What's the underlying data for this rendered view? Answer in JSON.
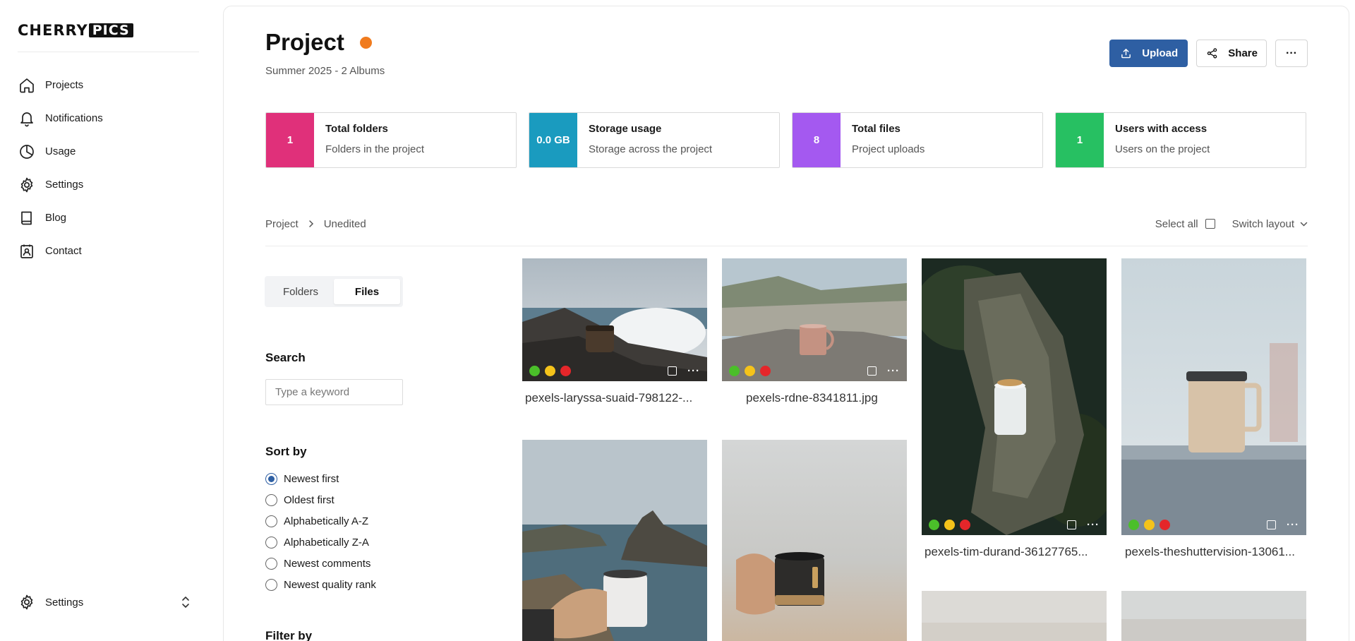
{
  "brand": {
    "logo_left": "CHERRY",
    "logo_right": "PICS"
  },
  "sidebar": {
    "items": [
      {
        "label": "Projects",
        "icon": "home-icon"
      },
      {
        "label": "Notifications",
        "icon": "bell-icon"
      },
      {
        "label": "Usage",
        "icon": "pie-chart-icon"
      },
      {
        "label": "Settings",
        "icon": "gear-icon"
      },
      {
        "label": "Blog",
        "icon": "book-icon"
      },
      {
        "label": "Contact",
        "icon": "contact-icon"
      }
    ],
    "bottom": {
      "label": "Settings",
      "icon": "gear-icon",
      "toggle_icon": "chevron-up-down-icon"
    }
  },
  "header": {
    "title": "Project",
    "status_color": "#f07b1e",
    "subtitle": "Summer 2025 - 2 Albums",
    "upload_label": "Upload",
    "share_label": "Share",
    "more_label": "···"
  },
  "stats": [
    {
      "value": "1",
      "title": "Total folders",
      "subtitle": "Folders in the project",
      "color": "#e0307a"
    },
    {
      "value": "0.0 GB",
      "title": "Storage usage",
      "subtitle": "Storage across the project",
      "color": "#1a9bbf"
    },
    {
      "value": "8",
      "title": "Total files",
      "subtitle": "Project uploads",
      "color": "#a459f0"
    },
    {
      "value": "1",
      "title": "Users with access",
      "subtitle": "Users on the project",
      "color": "#27c062"
    }
  ],
  "breadcrumb": {
    "root": "Project",
    "current": "Unedited"
  },
  "toolbar": {
    "select_all": "Select all",
    "switch_layout": "Switch layout"
  },
  "view_toggle": {
    "folders": "Folders",
    "files": "Files",
    "active": "Files"
  },
  "search": {
    "label": "Search",
    "placeholder": "Type a keyword",
    "value": ""
  },
  "sort": {
    "label": "Sort by",
    "options": [
      "Newest first",
      "Oldest first",
      "Alphabetically A-Z",
      "Alphabetically Z-A",
      "Newest comments",
      "Newest quality rank"
    ],
    "selected": "Newest first"
  },
  "filter": {
    "label": "Filter by"
  },
  "files": [
    {
      "name": "pexels-laryssa-suaid-798122-...",
      "labels": [
        "green",
        "yellow",
        "red"
      ]
    },
    {
      "name": "pexels-rdne-8341811.jpg",
      "labels": [
        "green",
        "yellow",
        "red"
      ]
    },
    {
      "name": "pexels-tim-durand-36127765...",
      "labels": [
        "green",
        "yellow",
        "red"
      ]
    },
    {
      "name": "pexels-theshuttervision-13061...",
      "labels": [
        "green",
        "yellow",
        "red"
      ]
    }
  ],
  "colors": {
    "accent": "#2e5fa3",
    "label_green": "#4bbf2a",
    "label_yellow": "#f5c31a",
    "label_red": "#e5262a"
  }
}
